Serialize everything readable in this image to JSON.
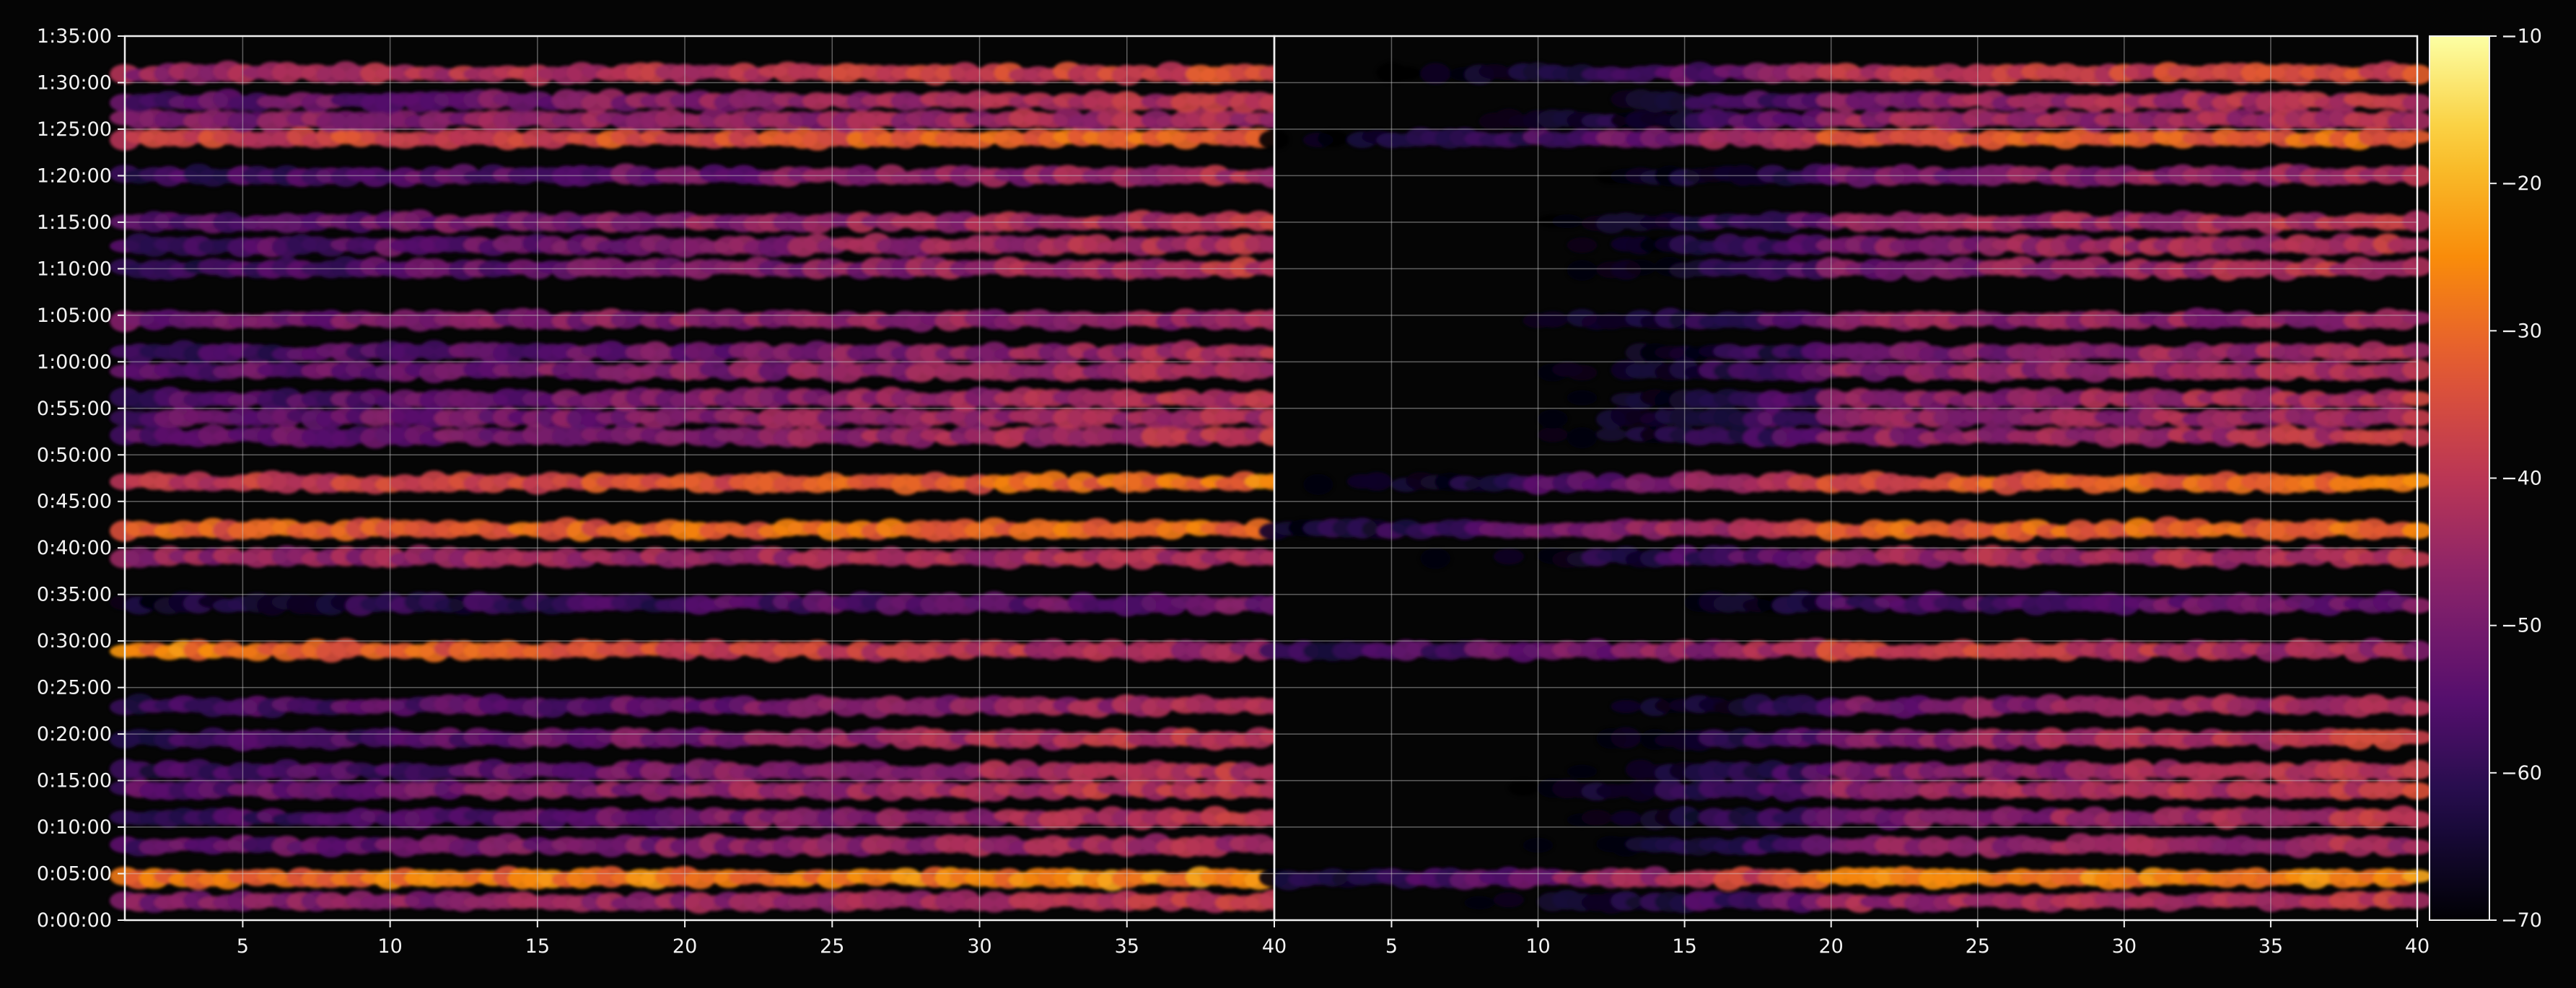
{
  "chart_data": {
    "type": "heatmap",
    "title": "",
    "xlabel": "",
    "ylabel": "",
    "background": "#050505",
    "colormap": "inferno",
    "colorbar": {
      "range": [
        -70,
        -10
      ],
      "ticks": [
        -70,
        -60,
        -50,
        -40,
        -30,
        -20,
        -10
      ],
      "tick_labels": [
        "−70",
        "−60",
        "−50",
        "−40",
        "−30",
        "−20",
        "−10"
      ]
    },
    "y_axis": {
      "range_seconds": [
        0,
        5700
      ],
      "ticks_seconds": [
        0,
        300,
        600,
        900,
        1200,
        1500,
        1800,
        2100,
        2400,
        2700,
        3000,
        3300,
        3600,
        3900,
        4200,
        4500,
        4800,
        5100,
        5400,
        5700
      ],
      "tick_labels": [
        "0:00:00",
        "0:05:00",
        "0:10:00",
        "0:15:00",
        "0:20:00",
        "0:25:00",
        "0:30:00",
        "0:35:00",
        "0:40:00",
        "0:45:00",
        "0:50:00",
        "0:55:00",
        "1:00:00",
        "1:05:00",
        "1:10:00",
        "1:15:00",
        "1:20:00",
        "1:25:00",
        "1:30:00",
        "1:35:00"
      ]
    },
    "panels": [
      {
        "name": "",
        "x_range": [
          1,
          40
        ],
        "x_ticks": [
          5,
          10,
          15,
          20,
          25,
          30,
          35,
          40
        ],
        "x_tick_labels": [
          "5",
          "10",
          "15",
          "20",
          "25",
          "30",
          "35",
          "40"
        ],
        "early_attenuation": false
      },
      {
        "name": "",
        "x_range": [
          1,
          40
        ],
        "x_ticks": [
          5,
          10,
          15,
          20,
          25,
          30,
          35,
          40
        ],
        "x_tick_labels": [
          "5",
          "10",
          "15",
          "20",
          "25",
          "30",
          "35",
          "40"
        ],
        "early_attenuation": true
      }
    ],
    "bands": [
      {
        "t_seconds": 120,
        "level_low_x": -50,
        "level_high_x": -40
      },
      {
        "t_seconds": 270,
        "level_low_x": -30,
        "level_high_x": -25
      },
      {
        "t_seconds": 480,
        "level_low_x": -55,
        "level_high_x": -42
      },
      {
        "t_seconds": 660,
        "level_low_x": -60,
        "level_high_x": -40
      },
      {
        "t_seconds": 840,
        "level_low_x": -55,
        "level_high_x": -38
      },
      {
        "t_seconds": 960,
        "level_low_x": -60,
        "level_high_x": -40
      },
      {
        "t_seconds": 1170,
        "level_low_x": -60,
        "level_high_x": -38
      },
      {
        "t_seconds": 1380,
        "level_low_x": -60,
        "level_high_x": -42
      },
      {
        "t_seconds": 1740,
        "level_low_x": -27,
        "level_high_x": -45
      },
      {
        "t_seconds": 2040,
        "level_low_x": -65,
        "level_high_x": -50
      },
      {
        "t_seconds": 2340,
        "level_low_x": -47,
        "level_high_x": -42
      },
      {
        "t_seconds": 2520,
        "level_low_x": -32,
        "level_high_x": -30
      },
      {
        "t_seconds": 2820,
        "level_low_x": -40,
        "level_high_x": -28
      },
      {
        "t_seconds": 3120,
        "level_low_x": -55,
        "level_high_x": -40
      },
      {
        "t_seconds": 3240,
        "level_low_x": -55,
        "level_high_x": -42
      },
      {
        "t_seconds": 3360,
        "level_low_x": -58,
        "level_high_x": -40
      },
      {
        "t_seconds": 3540,
        "level_low_x": -55,
        "level_high_x": -42
      },
      {
        "t_seconds": 3660,
        "level_low_x": -60,
        "level_high_x": -42
      },
      {
        "t_seconds": 3870,
        "level_low_x": -50,
        "level_high_x": -45
      },
      {
        "t_seconds": 4200,
        "level_low_x": -60,
        "level_high_x": -40
      },
      {
        "t_seconds": 4350,
        "level_low_x": -58,
        "level_high_x": -40
      },
      {
        "t_seconds": 4500,
        "level_low_x": -55,
        "level_high_x": -40
      },
      {
        "t_seconds": 4800,
        "level_low_x": -60,
        "level_high_x": -42
      },
      {
        "t_seconds": 5040,
        "level_low_x": -38,
        "level_high_x": -30
      },
      {
        "t_seconds": 5160,
        "level_low_x": -50,
        "level_high_x": -42
      },
      {
        "t_seconds": 5280,
        "level_low_x": -55,
        "level_high_x": -40
      },
      {
        "t_seconds": 5460,
        "level_low_x": -45,
        "level_high_x": -35
      }
    ]
  }
}
